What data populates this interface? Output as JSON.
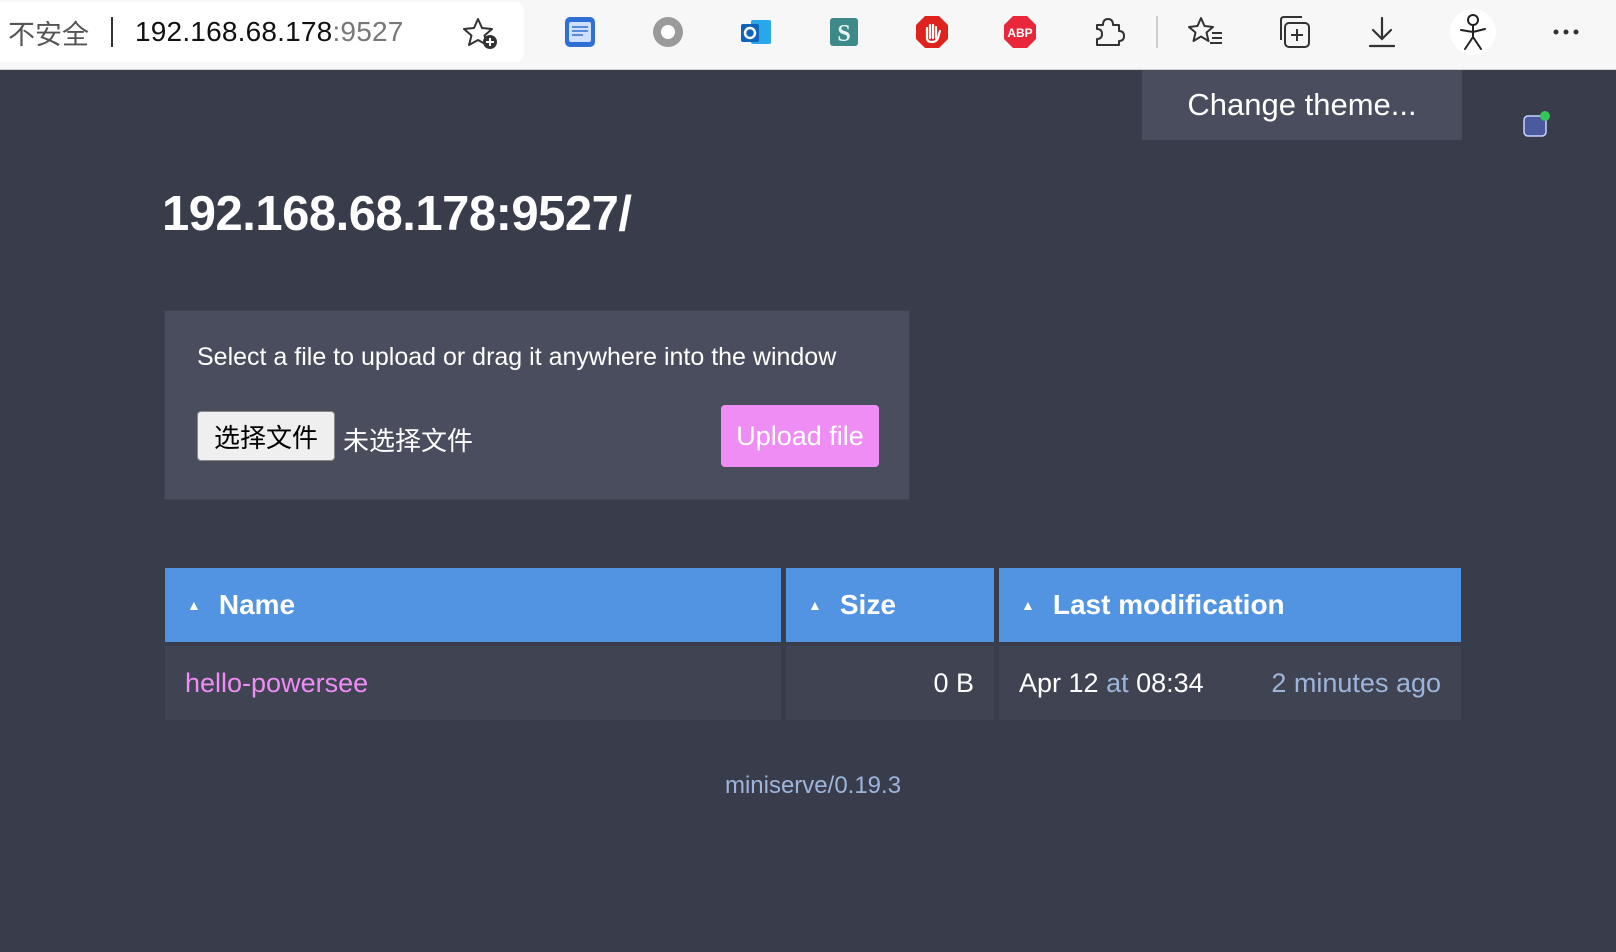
{
  "browser": {
    "security_label": "不安全",
    "url_host": "192.168.68.178",
    "url_port": ":9527",
    "icons": [
      "favorite-add-icon",
      "book-extension-icon",
      "circle-extension-icon",
      "outlook-icon",
      "s-extension-icon",
      "stop-hand-icon",
      "abp-icon",
      "puzzle-icon",
      "favorites-icon",
      "collections-icon",
      "download-icon",
      "profile-icon",
      "more-icon"
    ],
    "abp_text": "ABP"
  },
  "theme": {
    "label": "Change theme..."
  },
  "page": {
    "title": "192.168.68.178:9527/"
  },
  "upload": {
    "hint": "Select a file to upload or drag it anywhere into the window",
    "choose_label": "选择文件",
    "no_file_label": "未选择文件",
    "upload_label": "Upload file"
  },
  "table": {
    "headers": [
      "Name",
      "Size",
      "Last modification"
    ],
    "sort_glyph": "▲",
    "rows": [
      {
        "name": "hello-powersee",
        "size": "0 B",
        "date": "Apr 12",
        "at": "at",
        "time": "08:34",
        "ago": "2 minutes ago"
      }
    ]
  },
  "footer": {
    "version": "miniserve/0.19.3"
  },
  "colors": {
    "accent": "#5294e2",
    "link": "#ee8df4",
    "bg": "#393c4b",
    "muted": "#9eb5db"
  }
}
